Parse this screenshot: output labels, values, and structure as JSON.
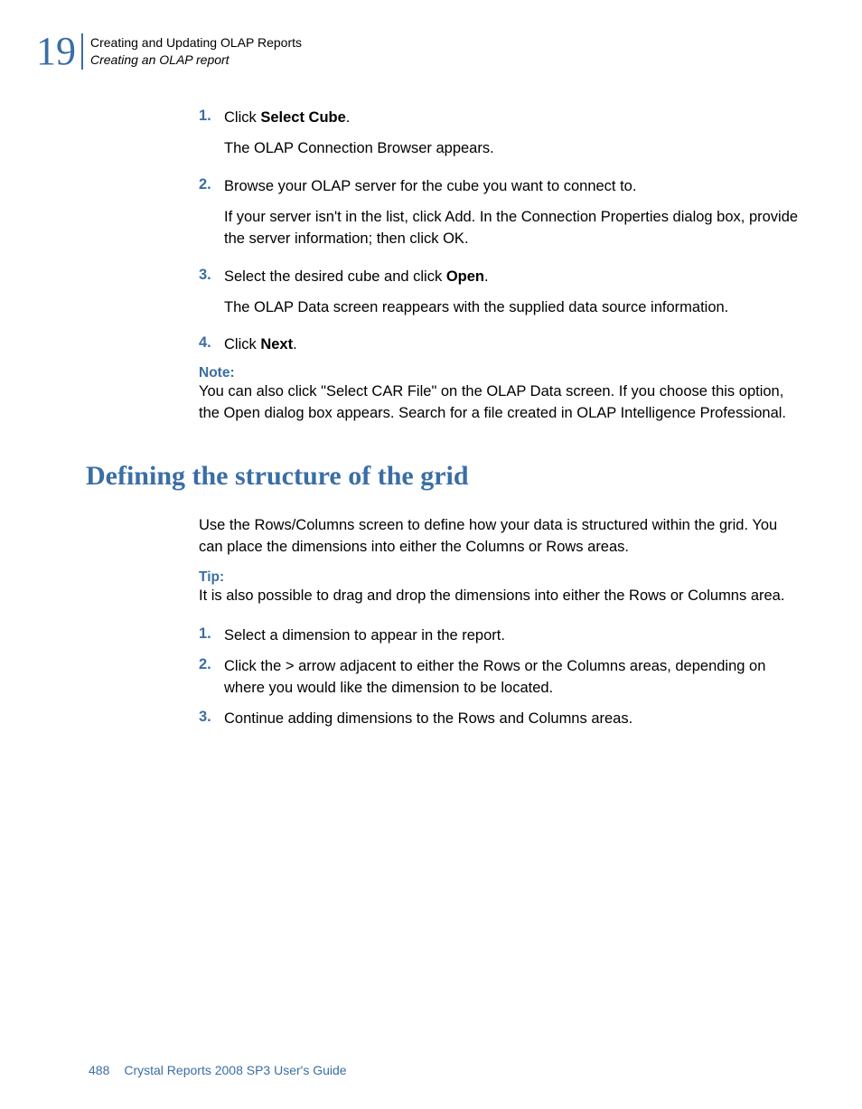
{
  "header": {
    "chapter_number": "19",
    "line1": "Creating and Updating OLAP Reports",
    "line2": "Creating an OLAP report"
  },
  "steps_a": [
    {
      "marker": "1.",
      "prefix": "Click ",
      "bold": "Select Cube",
      "suffix": ".",
      "after": "The OLAP Connection Browser appears."
    },
    {
      "marker": "2.",
      "text": "Browse your OLAP server for the cube you want to connect to.",
      "after": "If your server isn't in the list, click Add. In the Connection Properties dialog box, provide the server information; then click OK."
    },
    {
      "marker": "3.",
      "prefix": "Select the desired cube and click ",
      "bold": "Open",
      "suffix": ".",
      "after": "The OLAP Data screen reappears with the supplied data source information."
    },
    {
      "marker": "4.",
      "prefix": "Click ",
      "bold": "Next",
      "suffix": "."
    }
  ],
  "note": {
    "label": "Note:",
    "body": "You can also click \"Select CAR File\" on the OLAP Data screen. If you choose this option, the Open dialog box appears. Search for a file created in OLAP Intelligence Professional."
  },
  "section_heading": "Defining the structure of the grid",
  "section_intro": "Use the Rows/Columns screen to define how your data is structured within the grid. You can place the dimensions into either the Columns or Rows areas.",
  "tip": {
    "label": "Tip:",
    "body": "It is also possible to drag and drop the dimensions into either the Rows or Columns area."
  },
  "steps_b": [
    {
      "marker": "1.",
      "text": "Select a dimension to appear in the report."
    },
    {
      "marker": "2.",
      "text": "Click the > arrow adjacent to either the Rows or the Columns areas, depending on where you would like the dimension to be located."
    },
    {
      "marker": "3.",
      "text": "Continue adding dimensions to the Rows and Columns areas."
    }
  ],
  "footer": {
    "page": "488",
    "title": "Crystal Reports 2008 SP3 User's Guide"
  }
}
